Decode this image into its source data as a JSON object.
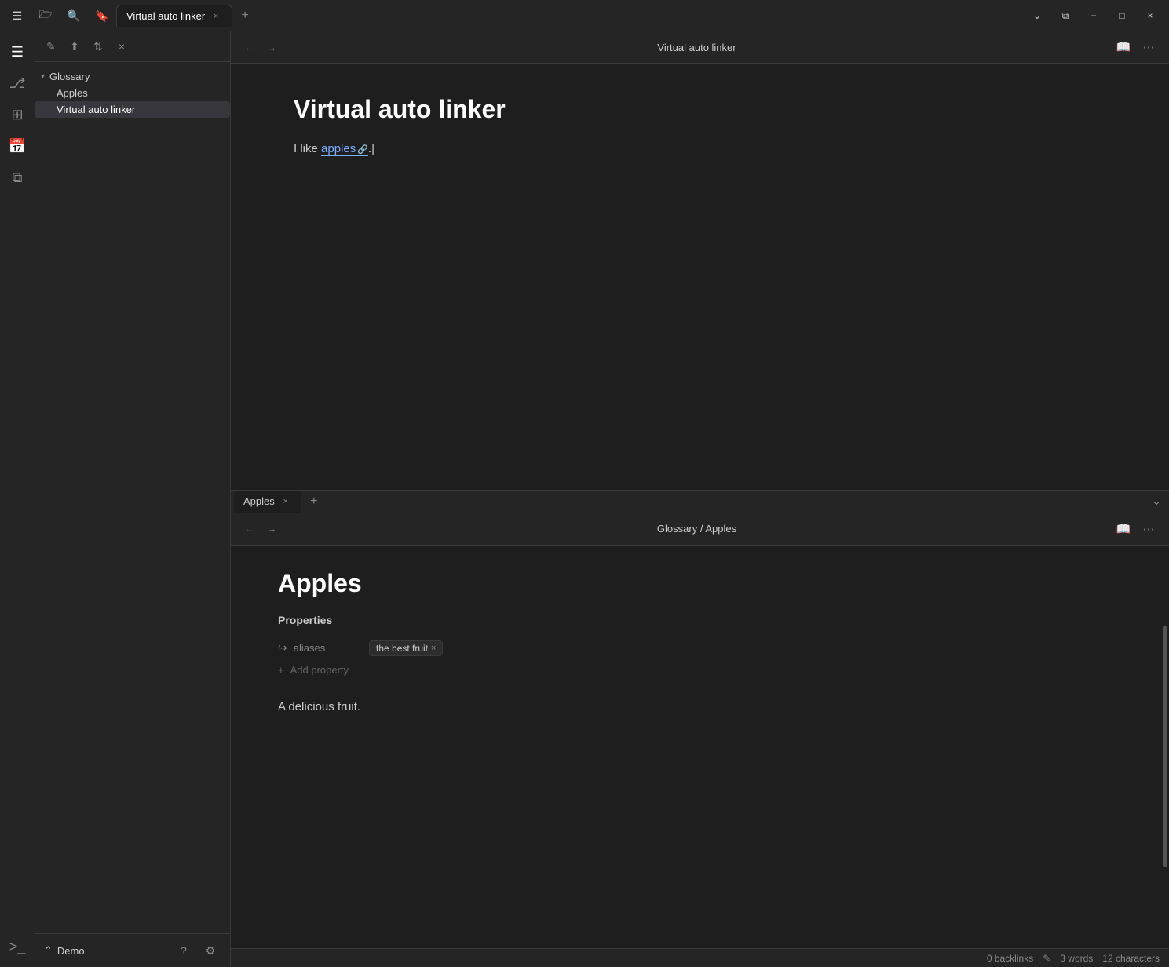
{
  "titlebar": {
    "tab_label": "Virtual auto linker",
    "tab_close": "×",
    "add_tab": "+",
    "minimize": "−",
    "maximize": "□",
    "close": "×",
    "dropdown": "⌄",
    "split": "⧉"
  },
  "activity_bar": {
    "icons": [
      "☰",
      "⎇",
      "⊞",
      "📅",
      "⧉",
      ">_"
    ]
  },
  "sidebar": {
    "toolbar": {
      "edit_icon": "✎",
      "upload_icon": "⬆",
      "sort_icon": "⇅",
      "close_icon": "×"
    },
    "folder": {
      "label": "Glossary",
      "arrow": "▾"
    },
    "files": [
      {
        "label": "Apples",
        "active": false
      },
      {
        "label": "Virtual auto linker",
        "active": true
      }
    ],
    "footer": {
      "workspace": "Demo",
      "help_icon": "?",
      "settings_icon": "⚙"
    }
  },
  "top_pane": {
    "nav_back": "←",
    "nav_forward": "→",
    "title": "Virtual auto linker",
    "book_icon": "📖",
    "more_icon": "⋯",
    "doc_title": "Virtual auto linker",
    "doc_body_prefix": "I like ",
    "doc_link": "apples",
    "doc_link_icon": "🔗",
    "doc_body_suffix": ".|"
  },
  "bottom_pane": {
    "tab_label": "Apples",
    "tab_close": "×",
    "add_tab": "+",
    "collapse": "⌄",
    "nav_back": "←",
    "nav_forward": "→",
    "breadcrumb": "Glossary / Apples",
    "book_icon": "📖",
    "more_icon": "⋯",
    "doc_title": "Apples",
    "properties_section": {
      "title": "Properties",
      "alias_key_icon": "↪",
      "alias_key_label": "aliases",
      "alias_value": "the best fruit",
      "alias_remove": "×",
      "add_property_icon": "+",
      "add_property_label": "Add property"
    },
    "doc_body": "A delicious fruit."
  },
  "status_bar": {
    "backlinks": "0 backlinks",
    "edit_icon": "✎",
    "words": "3 words",
    "chars": "12 characters"
  }
}
